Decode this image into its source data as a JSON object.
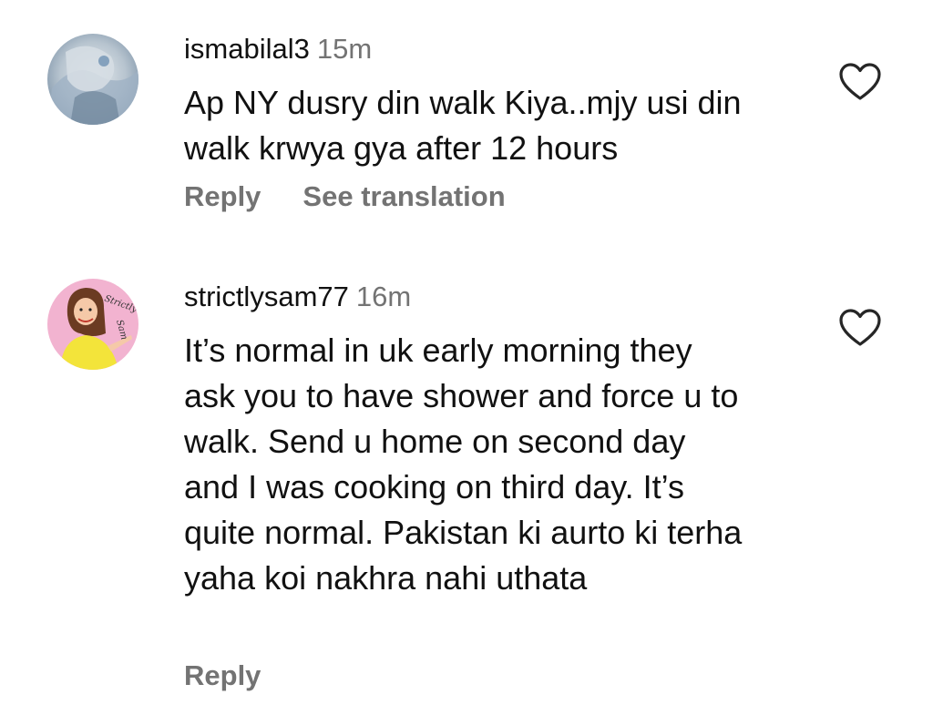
{
  "comments": [
    {
      "username": "ismabilal3",
      "time": "15m",
      "text": "Ap NY dusry din walk Kiya..mjy usi din walk krwya gya after 12 hours",
      "reply_label": "Reply",
      "translate_label": "See translation",
      "avatar_icon": "user-photo-avatar",
      "like_icon": "heart-outline-icon"
    },
    {
      "username": "strictlysam77",
      "time": "16m",
      "text": "It’s normal in uk early morning they ask you to have shower and force u to walk. Send u home on second day and I was cooking on third day. It’s quite normal. Pakistan ki aurto ki terha yaha koi nakhra nahi uthata",
      "reply_label": "Reply",
      "avatar_icon": "cartoon-avatar",
      "avatar_lettering": "Strictly Sam",
      "like_icon": "heart-outline-icon"
    }
  ],
  "colors": {
    "text": "#111111",
    "secondary": "#737373",
    "avatar2_bg": "#f2b3d0"
  }
}
